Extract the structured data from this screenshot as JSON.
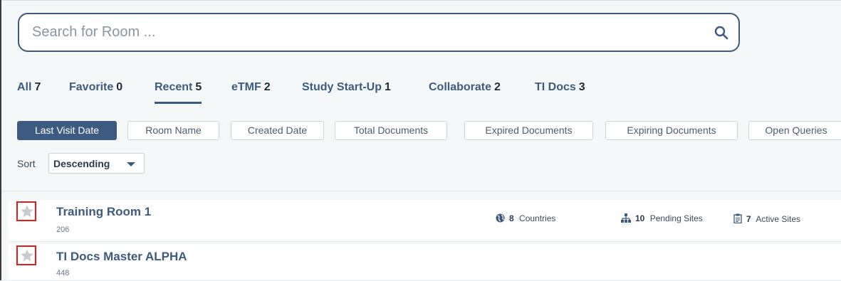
{
  "search": {
    "placeholder": "Search for Room ..."
  },
  "tabs": [
    {
      "label": "All",
      "count": "7"
    },
    {
      "label": "Favorite",
      "count": "0"
    },
    {
      "label": "Recent",
      "count": "5"
    },
    {
      "label": "eTMF",
      "count": "2"
    },
    {
      "label": "Study Start-Up",
      "count": "1"
    },
    {
      "label": "Collaborate",
      "count": "2"
    },
    {
      "label": "TI Docs",
      "count": "3"
    }
  ],
  "active_tab": "Recent",
  "sort_fields": [
    "Last Visit Date",
    "Room Name",
    "Created Date",
    "Total Documents",
    "Expired Documents",
    "Expiring Documents",
    "Open Queries"
  ],
  "active_sort_field": "Last Visit Date",
  "sort": {
    "label": "Sort",
    "value": "Descending"
  },
  "rooms": [
    {
      "title": "Training Room 1",
      "id": "206",
      "stats": {
        "countries": {
          "value": "8",
          "label": "Countries"
        },
        "pending_sites": {
          "value": "10",
          "label": "Pending Sites"
        },
        "active_sites": {
          "value": "7",
          "label": "Active Sites"
        }
      }
    },
    {
      "title": "TI Docs Master ALPHA",
      "id": "448"
    }
  ],
  "colors": {
    "accent": "#3d5a80",
    "highlight": "#e01e1e",
    "background": "#f4f8f9"
  }
}
